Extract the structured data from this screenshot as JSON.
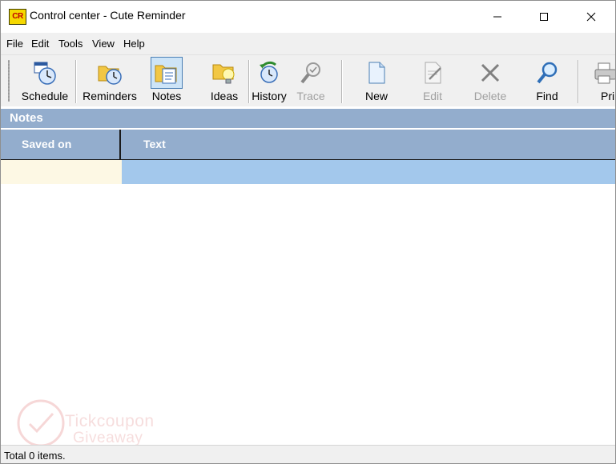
{
  "window": {
    "title": "Control center - Cute Reminder",
    "app_icon_text": "CR",
    "controls": [
      "minimize",
      "maximize",
      "close"
    ]
  },
  "menu": [
    "File",
    "Edit",
    "Tools",
    "View",
    "Help"
  ],
  "toolbar": {
    "buttons": [
      {
        "label": "Schedule",
        "icon": "schedule-icon",
        "enabled": true,
        "active": false
      },
      {
        "label": "Reminders",
        "icon": "reminders-icon",
        "enabled": true,
        "active": false
      },
      {
        "label": "Notes",
        "icon": "notes-icon",
        "enabled": true,
        "active": true
      },
      {
        "label": "Ideas",
        "icon": "ideas-icon",
        "enabled": true,
        "active": false
      },
      {
        "label": "History",
        "icon": "history-icon",
        "enabled": true,
        "active": false
      },
      {
        "label": "Trace",
        "icon": "trace-icon",
        "enabled": false,
        "active": false
      },
      {
        "label": "New",
        "icon": "new-icon",
        "enabled": true,
        "active": false
      },
      {
        "label": "Edit",
        "icon": "edit-icon",
        "enabled": false,
        "active": false
      },
      {
        "label": "Delete",
        "icon": "delete-icon",
        "enabled": false,
        "active": false
      },
      {
        "label": "Find",
        "icon": "find-icon",
        "enabled": true,
        "active": false
      },
      {
        "label": "Pri",
        "icon": "print-icon",
        "enabled": true,
        "active": false
      }
    ]
  },
  "panel": {
    "title": "Notes",
    "columns": [
      "Saved on",
      "Text"
    ],
    "rows": []
  },
  "watermark": {
    "line1": "Tickcoupon",
    "line2": "Giveaway"
  },
  "status": "Total 0 items.",
  "colors": {
    "header": "#93adcd",
    "selection": "#a3c8ec",
    "selection_first_cell": "#fdf8e4",
    "toolbar_bg": "#f0f0f0"
  }
}
